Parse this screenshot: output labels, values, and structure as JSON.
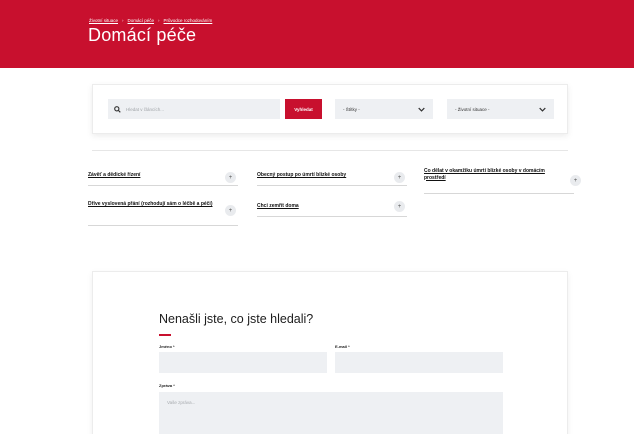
{
  "breadcrumb": {
    "items": [
      "Životní situace",
      "Domácí péče",
      "Průvodce rozhodováním"
    ],
    "separator": "›"
  },
  "page": {
    "title": "Domácí péče"
  },
  "search": {
    "placeholder": "Hledat v článcích...",
    "button_label": "Vyhledat",
    "topic_select": {
      "value": "- Štítky -"
    },
    "situation_select": {
      "value": "- Životní situace -"
    }
  },
  "topics": [
    {
      "label": "Závěť a dědické řízení"
    },
    {
      "label": "Obecný postup po úmrtí blízké osoby"
    },
    {
      "label": "Co dělat v okamžiku úmrtí blízké osoby v domácím prostředí"
    },
    {
      "label": "Dříve vyslovená přání (rozhodují sám o léčbě a péči)"
    },
    {
      "label": "Chci zemřít doma"
    }
  ],
  "topic_plus_symbol": "+",
  "form": {
    "title": "Nenašli jste, co jste hledali?",
    "name_label": "Jméno *",
    "email_label": "E-mail *",
    "message_label": "Zpráva *",
    "message_placeholder": "Vaše zpráva..."
  },
  "colors": {
    "brand_red": "#c8102e",
    "field_bg": "#eef0f3"
  }
}
